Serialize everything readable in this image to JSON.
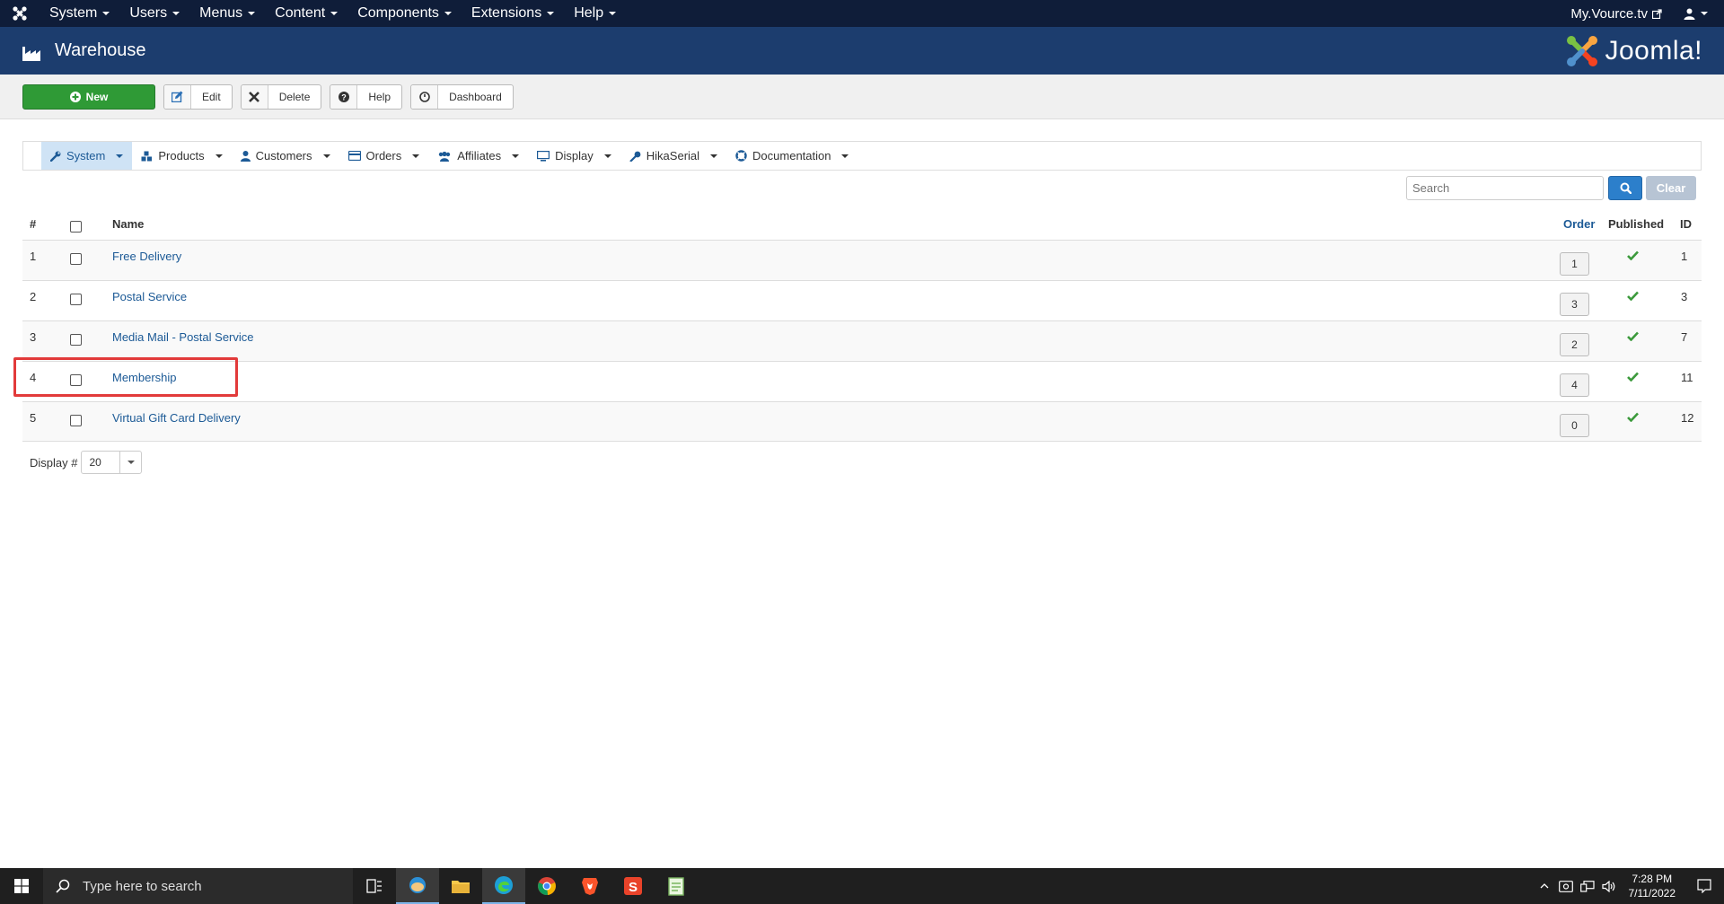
{
  "topbar": {
    "menus": [
      "System",
      "Users",
      "Menus",
      "Content",
      "Components",
      "Extensions",
      "Help"
    ],
    "site_link": "My.Vource.tv"
  },
  "header": {
    "title": "Warehouse",
    "brand": "Joomla!"
  },
  "toolbar": {
    "new_label": "New",
    "edit_label": "Edit",
    "delete_label": "Delete",
    "help_label": "Help",
    "dashboard_label": "Dashboard"
  },
  "submenu": {
    "items": [
      "System",
      "Products",
      "Customers",
      "Orders",
      "Affiliates",
      "Display",
      "HikaSerial",
      "Documentation"
    ]
  },
  "search": {
    "placeholder": "Search",
    "clear_label": "Clear"
  },
  "table": {
    "headers": {
      "num": "#",
      "name": "Name",
      "order": "Order",
      "published": "Published",
      "id": "ID"
    },
    "rows": [
      {
        "num": "1",
        "name": "Free Delivery",
        "order": "1",
        "id": "1"
      },
      {
        "num": "2",
        "name": "Postal Service",
        "order": "3",
        "id": "3"
      },
      {
        "num": "3",
        "name": "Media Mail - Postal Service",
        "order": "2",
        "id": "7"
      },
      {
        "num": "4",
        "name": "Membership",
        "order": "4",
        "id": "11"
      },
      {
        "num": "5",
        "name": "Virtual Gift Card Delivery",
        "order": "0",
        "id": "12"
      }
    ]
  },
  "pagination": {
    "display_label": "Display #",
    "display_value": "20"
  },
  "taskbar": {
    "search_placeholder": "Type here to search",
    "time": "7:28 PM",
    "date": "7/11/2022"
  },
  "colors": {
    "topbar": "#0f1d39",
    "header": "#1c3d6e",
    "new_button": "#2f9a36",
    "link": "#1c5a96",
    "published_check": "#3c9a3c",
    "highlight": "#e23a3a"
  }
}
